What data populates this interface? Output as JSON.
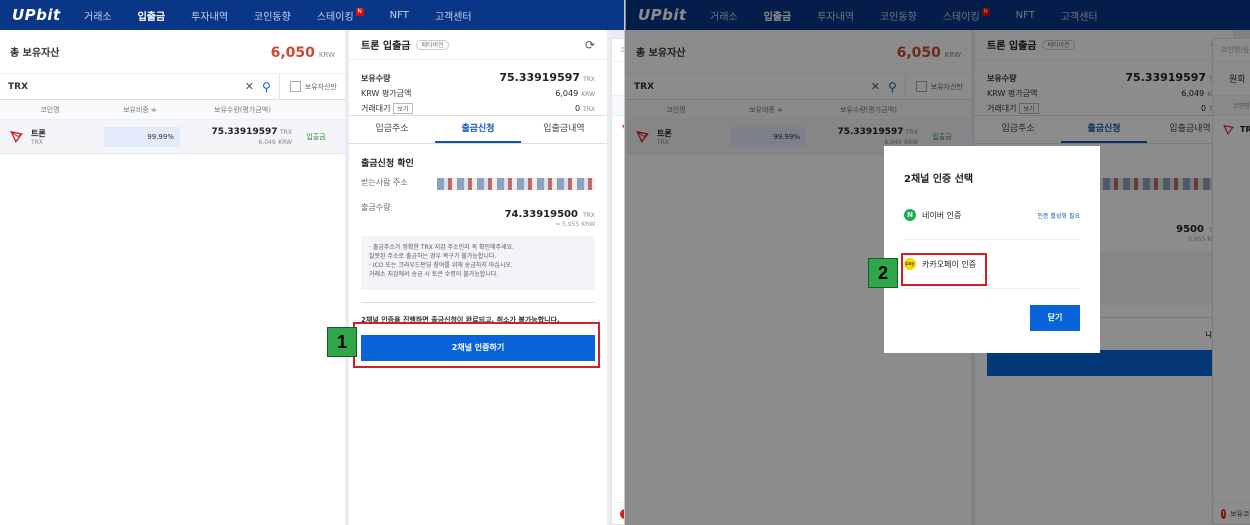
{
  "nav": {
    "logo": "UPbit",
    "items": [
      "거래소",
      "입출금",
      "투자내역",
      "코인동향",
      "스테이킹",
      "NFT",
      "고객센터"
    ],
    "new_badge": "N"
  },
  "holdings": {
    "total_label": "총 보유자산",
    "total_value": "6,050",
    "unit": "KRW",
    "search_value": "TRX",
    "only_held_label": "보유자산만",
    "headers": [
      "코인명",
      "보유비중 ≑",
      "보유수량(평가금액)"
    ],
    "row": {
      "name": "트론",
      "symbol": "TRX",
      "ratio": "99.99%",
      "amount": "75.33919597",
      "amount_unit": "TRX",
      "krw_value": "6,049",
      "krw_unit": "KRW",
      "action": "입출금"
    }
  },
  "deposit": {
    "title": "트론 입출금",
    "beta": "베타버전",
    "balance_label": "보유수량",
    "balance": "75.33919597",
    "balance_unit": "TRX",
    "krw_label": "KRW 평가금액",
    "krw_value": "6,049",
    "krw_unit": "KRW",
    "pending_label": "거래대기",
    "pending_btn": "보기",
    "pending_value": "0",
    "pending_unit": "TRX",
    "tabs": [
      "입금주소",
      "출금신청",
      "입출금내역"
    ],
    "confirm_title": "출금신청 확인",
    "recipient_label": "받는사람 주소",
    "amount_label": "출금수량",
    "amount": "74.33919500",
    "amount_unit": "TRX",
    "approx": "≈ 5,955 KRW",
    "notice": [
      "· 출금주소가 정확한 TRX 지갑 주소인지 꼭 확인해주세요.",
      "  잘못된 주소로 출금하는 경우 복구가 불가능합니다.",
      "· ICO 또는 크라우드펀딩 참여를 위해 송금하지 마십시오.",
      "  거래소 지갑에서 송금 시 토큰 수령이 불가능합니다."
    ],
    "warning": "2채널 인증을 진행하면 출금신청이 완료되고, 취소가 불가능합니다.",
    "auth_button": "2채널 인증하기"
  },
  "coin_list": {
    "search_placeholder": "코인명/심볼검색",
    "tab": "원화",
    "header": "코인명",
    "row": "TRX",
    "bottom": "보유코인 현황"
  },
  "right_partial": {
    "krw_value": "6,049",
    "krw_unit": "KRW",
    "pending_value": "0",
    "pending_unit": "TRX",
    "amount_frag": "9500",
    "amount_unit": "TRX",
    "approx_frag": "5,955 KRW",
    "q_frag": "Q",
    "warn_frag": "니다."
  },
  "modal": {
    "title": "2채널 인증 선택",
    "options": [
      {
        "icon": "N",
        "label": "네이버 인증",
        "note": "인증 활성화 필요"
      },
      {
        "icon": "pay",
        "label": "카카오페이 인증",
        "note": ""
      }
    ],
    "close": "닫기"
  },
  "steps": [
    "1",
    "2"
  ],
  "colors": {
    "nav": "#093687",
    "accent": "#0964d9",
    "total": "#c84a31",
    "annotation": "#d31e2a",
    "step_bg": "#2fa64a"
  }
}
